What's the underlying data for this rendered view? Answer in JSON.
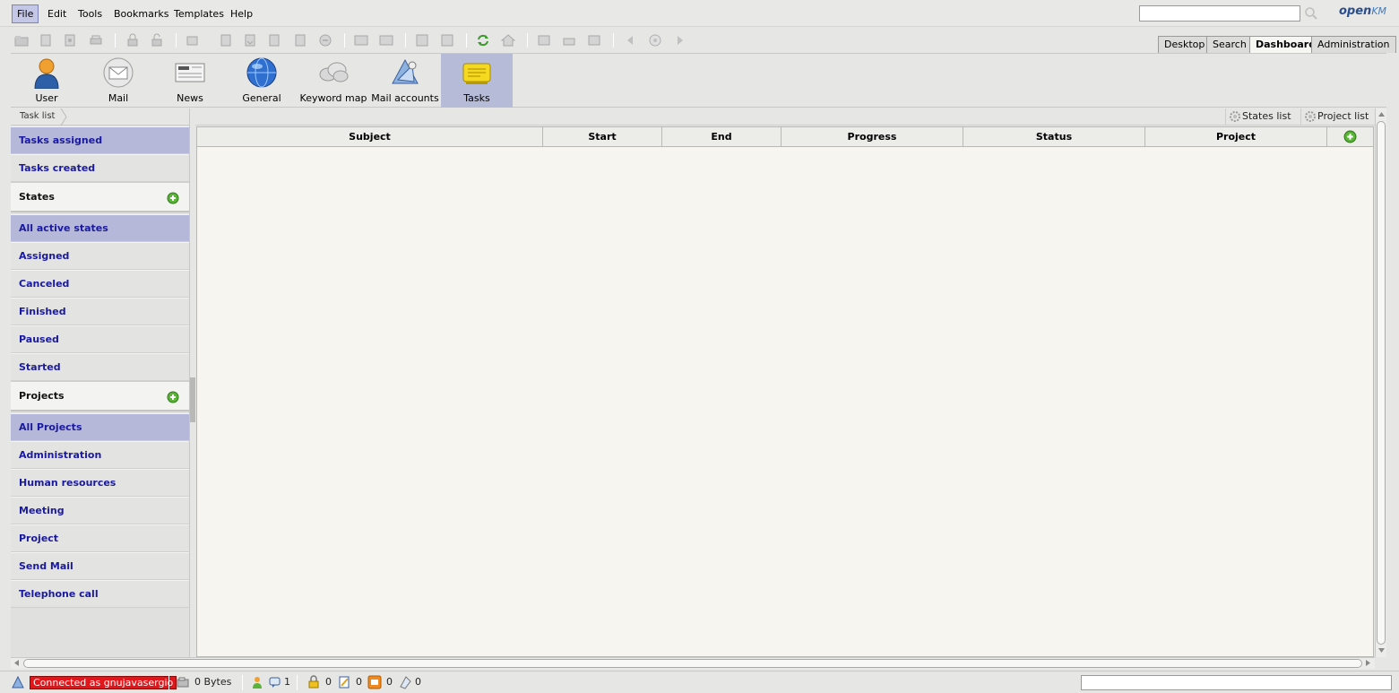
{
  "menu": {
    "items": [
      {
        "label": "File",
        "active": true
      },
      {
        "label": "Edit"
      },
      {
        "label": "Tools"
      },
      {
        "label": "Bookmarks"
      },
      {
        "label": "Templates"
      },
      {
        "label": "Help"
      }
    ],
    "search_value": "",
    "logo_main": "open",
    "logo_suffix": "KM"
  },
  "workspace_tabs": [
    {
      "label": "Desktop"
    },
    {
      "label": "Search"
    },
    {
      "label": "Dashboard",
      "active": true
    },
    {
      "label": "Administration"
    }
  ],
  "dashboard": {
    "items": [
      {
        "label": "User",
        "icon": "user-icon"
      },
      {
        "label": "Mail",
        "icon": "mail-icon"
      },
      {
        "label": "News",
        "icon": "news-icon"
      },
      {
        "label": "General",
        "icon": "globe-icon"
      },
      {
        "label": "Keyword map",
        "icon": "cloud-icon"
      },
      {
        "label": "Mail accounts",
        "icon": "mail-accounts-icon"
      },
      {
        "label": "Tasks",
        "icon": "tasks-icon",
        "active": true
      }
    ]
  },
  "left": {
    "breadcrumb": "Task list",
    "tasks_assigned": "Tasks assigned",
    "tasks_created": "Tasks created",
    "states_header": "States",
    "states": [
      "All active states",
      "Assigned",
      "Canceled",
      "Finished",
      "Paused",
      "Started"
    ],
    "projects_header": "Projects",
    "projects": [
      "All Projects",
      "Administration",
      "Human resources",
      "Meeting",
      "Project",
      "Send Mail",
      "Telephone call"
    ]
  },
  "main": {
    "states_list_label": "States list",
    "project_list_label": "Project list",
    "columns": [
      "Subject",
      "Start",
      "End",
      "Progress",
      "Status",
      "Project"
    ]
  },
  "status": {
    "connected": "Connected as gnujavasergio",
    "bytes": "0 Bytes",
    "users_count": "1",
    "locked_count": "0",
    "checkout_count": "0",
    "mail_count": "0",
    "subscribed_count": "0"
  },
  "colors": {
    "accent": "#b5b8d9",
    "link": "#1a1aa0",
    "connected_bg": "#e0161b"
  }
}
